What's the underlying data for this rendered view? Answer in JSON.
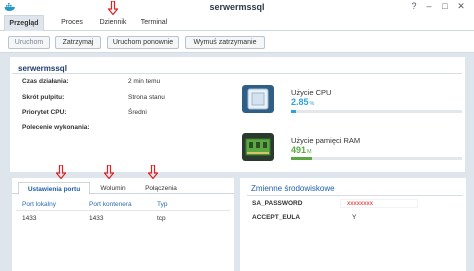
{
  "window": {
    "title": "serwermssql",
    "controls": [
      "?",
      "–",
      "□",
      "✕"
    ]
  },
  "tabs": [
    {
      "label": "Przegląd",
      "active": true
    },
    {
      "label": "Proces",
      "active": false
    },
    {
      "label": "Dziennik",
      "active": false
    },
    {
      "label": "Terminal",
      "active": false
    }
  ],
  "toolbar": {
    "start_label": "Uruchom",
    "stop_label": "Zatrzymaj",
    "restart_label": "Uruchom ponownie",
    "force_stop_label": "Wymuś zatrzymanie"
  },
  "overview": {
    "name": "serwermssql",
    "rows": [
      {
        "label": "Czas działania:",
        "value": "2 min temu"
      },
      {
        "label": "Skrót pulpitu:",
        "value": "Strona stanu"
      },
      {
        "label": "Priorytet CPU:",
        "value": "Średni"
      },
      {
        "label": "Polecenie wykonania:",
        "value": ""
      }
    ]
  },
  "resources": {
    "cpu": {
      "label": "Użycie CPU",
      "value": "2.85",
      "unit": "%",
      "fraction": 0.0285
    },
    "ram": {
      "label": "Użycie pamięci RAM",
      "value": "491",
      "unit": "M",
      "fraction": 0.12
    }
  },
  "subtabs": [
    {
      "label": "Ustawienia portu",
      "active": true
    },
    {
      "label": "Wolumin",
      "active": false
    },
    {
      "label": "Połączenia",
      "active": false
    }
  ],
  "ports": {
    "headers": [
      "Port lokalny",
      "Port kontenera",
      "Typ"
    ],
    "rows": [
      [
        "1433",
        "1433",
        "tcp"
      ]
    ]
  },
  "env": {
    "title": "Zmienne środowiskowe",
    "rows": [
      {
        "key": "SA_PASSWORD",
        "value": "xxxxxxxx"
      },
      {
        "key": "ACCEPT_EULA",
        "value": "Y"
      }
    ]
  },
  "colors": {
    "accent": "#2fa3d8",
    "title": "#1f3c6b",
    "annotation_arrow": "#e02020"
  }
}
